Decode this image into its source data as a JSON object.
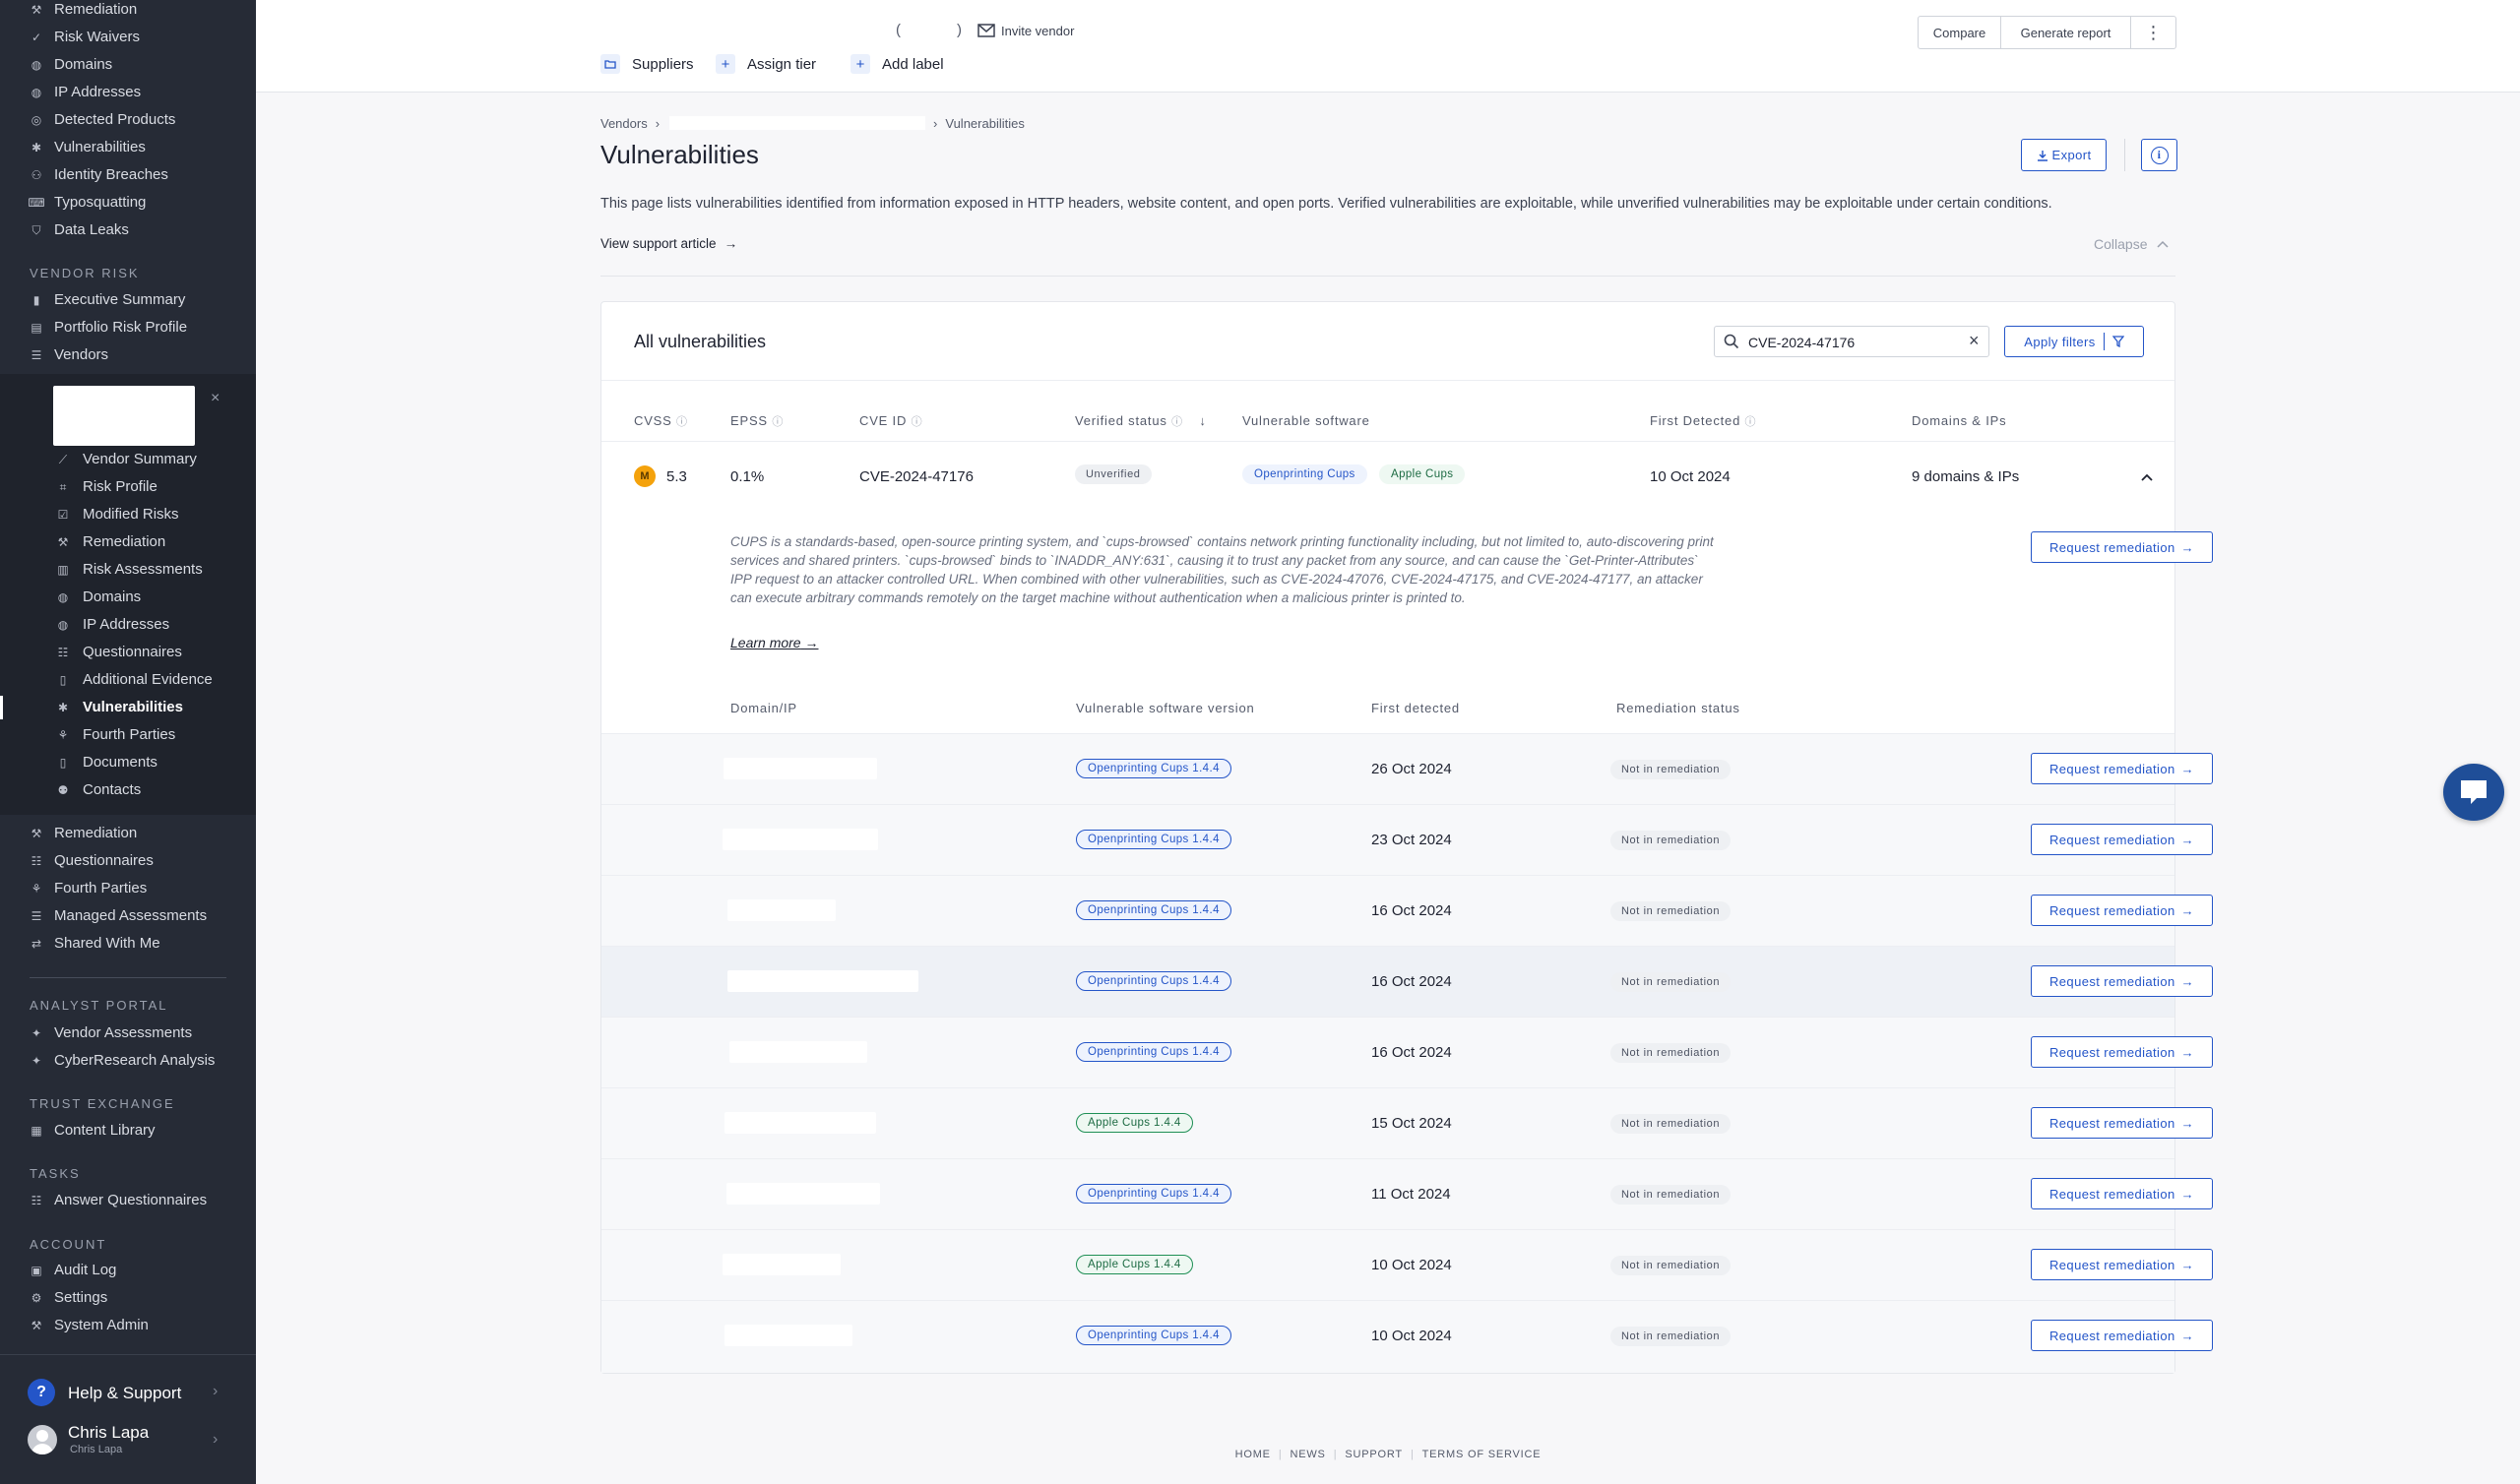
{
  "sidebar": {
    "top_items": [
      {
        "label": "Remediation",
        "icon": "wrench-icon"
      },
      {
        "label": "Risk Waivers",
        "icon": "check-icon"
      },
      {
        "label": "Domains",
        "icon": "globe-icon"
      },
      {
        "label": "IP Addresses",
        "icon": "globe-icon"
      },
      {
        "label": "Detected Products",
        "icon": "target-icon"
      },
      {
        "label": "Vulnerabilities",
        "icon": "bug-icon"
      },
      {
        "label": "Identity Breaches",
        "icon": "user-icon"
      },
      {
        "label": "Typosquatting",
        "icon": "typo-icon"
      },
      {
        "label": "Data Leaks",
        "icon": "shield-icon"
      }
    ],
    "vendor_risk_title": "VENDOR RISK",
    "vendor_risk_items": [
      {
        "label": "Executive Summary",
        "icon": "bar-chart-icon"
      },
      {
        "label": "Portfolio Risk Profile",
        "icon": "document-icon"
      },
      {
        "label": "Vendors",
        "icon": "list-icon"
      }
    ],
    "vendor_sub_items": [
      {
        "label": "Vendor Summary",
        "icon": "trend-icon"
      },
      {
        "label": "Risk Profile",
        "icon": "scan-icon"
      },
      {
        "label": "Modified Risks",
        "icon": "checkbox-icon"
      },
      {
        "label": "Remediation",
        "icon": "wrench-icon"
      },
      {
        "label": "Risk Assessments",
        "icon": "clipboard-icon"
      },
      {
        "label": "Domains",
        "icon": "globe-icon"
      },
      {
        "label": "IP Addresses",
        "icon": "globe-icon"
      },
      {
        "label": "Questionnaires",
        "icon": "checklist-icon"
      },
      {
        "label": "Additional Evidence",
        "icon": "file-icon"
      },
      {
        "label": "Vulnerabilities",
        "icon": "bug-icon"
      },
      {
        "label": "Fourth Parties",
        "icon": "network-icon"
      },
      {
        "label": "Documents",
        "icon": "file-icon"
      },
      {
        "label": "Contacts",
        "icon": "users-icon"
      }
    ],
    "middle_items": [
      {
        "label": "Remediation",
        "icon": "wrench-icon"
      },
      {
        "label": "Questionnaires",
        "icon": "checklist-icon"
      },
      {
        "label": "Fourth Parties",
        "icon": "network-icon"
      },
      {
        "label": "Managed Assessments",
        "icon": "list-icon"
      },
      {
        "label": "Shared With Me",
        "icon": "share-icon"
      }
    ],
    "analyst_title": "ANALYST PORTAL",
    "analyst_items": [
      {
        "label": "Vendor Assessments",
        "icon": "bolt-icon"
      },
      {
        "label": "CyberResearch Analysis",
        "icon": "bolt-icon"
      }
    ],
    "trust_title": "TRUST EXCHANGE",
    "trust_items": [
      {
        "label": "Content Library",
        "icon": "library-icon"
      }
    ],
    "tasks_title": "TASKS",
    "tasks_items": [
      {
        "label": "Answer Questionnaires",
        "icon": "checklist-icon"
      }
    ],
    "account_title": "ACCOUNT",
    "account_items": [
      {
        "label": "Audit Log",
        "icon": "log-icon"
      },
      {
        "label": "Settings",
        "icon": "gear-icon"
      },
      {
        "label": "System Admin",
        "icon": "wrench-icon"
      }
    ],
    "help_label": "Help & Support",
    "user_name": "Chris Lapa",
    "user_sub": "Chris Lapa"
  },
  "topbar": {
    "paren_open": "(",
    "paren_close": ")",
    "invite_vendor": "Invite vendor",
    "compare": "Compare",
    "generate_report": "Generate report",
    "suppliers": "Suppliers",
    "assign_tier": "Assign tier",
    "add_label": "Add label"
  },
  "breadcrumb": {
    "vendors": "Vendors",
    "current": "Vulnerabilities"
  },
  "page": {
    "title": "Vulnerabilities",
    "export": "Export",
    "description": "This page lists vulnerabilities identified from information exposed in HTTP headers, website content, and open ports. Verified vulnerabilities are exploitable, while unverified vulnerabilities may be exploitable under certain conditions.",
    "support_link": "View support article",
    "collapse": "Collapse"
  },
  "card": {
    "title": "All vulnerabilities",
    "search_value": "CVE-2024-47176",
    "apply_filters": "Apply filters",
    "columns": {
      "cvss": "CVSS",
      "epss": "EPSS",
      "cve_id": "CVE ID",
      "verified_status": "Verified status",
      "vulnerable_software": "Vulnerable software",
      "first_detected": "First Detected",
      "domains_ips": "Domains & IPs"
    },
    "vuln": {
      "severity_letter": "M",
      "cvss": "5.3",
      "epss": "0.1%",
      "cve_id": "CVE-2024-47176",
      "status": "Unverified",
      "software": [
        "Openprinting Cups",
        "Apple Cups"
      ],
      "first_detected": "10 Oct 2024",
      "domains": "9 domains & IPs",
      "description": "CUPS is a standards-based, open-source printing system, and `cups-browsed` contains network printing functionality including, but not limited to, auto-discovering print services and shared printers. `cups-browsed` binds to `INADDR_ANY:631`, causing it to trust any packet from any source, and can cause the `Get-Printer-Attributes` IPP request to an attacker controlled URL. When combined with other vulnerabilities, such as CVE-2024-47076, CVE-2024-47175, and CVE-2024-47177, an attacker can execute arbitrary commands remotely on the target machine without authentication when a malicious printer is printed to.",
      "learn_more": "Learn more",
      "request_remediation": "Request remediation"
    },
    "sub_columns": {
      "domain_ip": "Domain/IP",
      "software_version": "Vulnerable software version",
      "first_detected": "First detected",
      "remediation_status": "Remediation status"
    },
    "rows": [
      {
        "software": "Openprinting Cups 1.4.4",
        "date": "26 Oct 2024",
        "status": "Not in remediation",
        "action": "Request remediation"
      },
      {
        "software": "Openprinting Cups 1.4.4",
        "date": "23 Oct 2024",
        "status": "Not in remediation",
        "action": "Request remediation"
      },
      {
        "software": "Openprinting Cups 1.4.4",
        "date": "16 Oct 2024",
        "status": "Not in remediation",
        "action": "Request remediation"
      },
      {
        "software": "Openprinting Cups 1.4.4",
        "date": "16 Oct 2024",
        "status": "Not in remediation",
        "action": "Request remediation"
      },
      {
        "software": "Openprinting Cups 1.4.4",
        "date": "16 Oct 2024",
        "status": "Not in remediation",
        "action": "Request remediation"
      },
      {
        "software": "Apple Cups 1.4.4",
        "date": "15 Oct 2024",
        "status": "Not in remediation",
        "action": "Request remediation"
      },
      {
        "software": "Openprinting Cups 1.4.4",
        "date": "11 Oct 2024",
        "status": "Not in remediation",
        "action": "Request remediation"
      },
      {
        "software": "Apple Cups 1.4.4",
        "date": "10 Oct 2024",
        "status": "Not in remediation",
        "action": "Request remediation"
      },
      {
        "software": "Openprinting Cups 1.4.4",
        "date": "10 Oct 2024",
        "status": "Not in remediation",
        "action": "Request remediation"
      }
    ]
  },
  "footer": {
    "home": "HOME",
    "news": "NEWS",
    "support": "SUPPORT",
    "terms": "TERMS OF SERVICE"
  },
  "colors": {
    "accent": "#2455c8",
    "sidebar": "#262b36",
    "severity_medium": "#f4a20c"
  }
}
